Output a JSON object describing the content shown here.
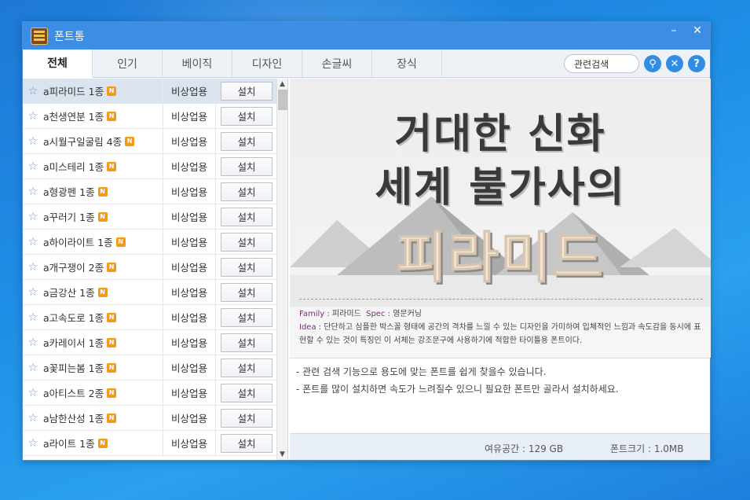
{
  "window": {
    "title": "폰트통"
  },
  "tabs": [
    {
      "label": "전체",
      "active": true
    },
    {
      "label": "인기",
      "active": false
    },
    {
      "label": "베이직",
      "active": false
    },
    {
      "label": "디자인",
      "active": false
    },
    {
      "label": "손글씨",
      "active": false
    },
    {
      "label": "장식",
      "active": false
    }
  ],
  "search": {
    "value": "관련검색"
  },
  "fonts": [
    {
      "name": "a피라미드 1종",
      "license": "비상업용",
      "action": "설치"
    },
    {
      "name": "a천생연분 1종",
      "license": "비상업용",
      "action": "설치"
    },
    {
      "name": "a시월구일굴림 4종",
      "license": "비상업용",
      "action": "설치"
    },
    {
      "name": "a미스테리 1종",
      "license": "비상업용",
      "action": "설치"
    },
    {
      "name": "a형광펜 1종",
      "license": "비상업용",
      "action": "설치"
    },
    {
      "name": "a꾸러기 1종",
      "license": "비상업용",
      "action": "설치"
    },
    {
      "name": "a하이라이트 1종",
      "license": "비상업용",
      "action": "설치"
    },
    {
      "name": "a개구쟁이 2종",
      "license": "비상업용",
      "action": "설치"
    },
    {
      "name": "a금강산 1종",
      "license": "비상업용",
      "action": "설치"
    },
    {
      "name": "a고속도로 1종",
      "license": "비상업용",
      "action": "설치"
    },
    {
      "name": "a카레이서 1종",
      "license": "비상업용",
      "action": "설치"
    },
    {
      "name": "a꽃피는봄 1종",
      "license": "비상업용",
      "action": "설치"
    },
    {
      "name": "a아티스트 2종",
      "license": "비상업용",
      "action": "설치"
    },
    {
      "name": "a남한산성 1종",
      "license": "비상업용",
      "action": "설치"
    },
    {
      "name": "a라이트 1종",
      "license": "비상업용",
      "action": "설치"
    }
  ],
  "badge_letter": "N",
  "preview": {
    "line1": "거대한 신화",
    "line2": "세계 불가사의",
    "line3": "피라미드",
    "family_label": "Family :",
    "family_value": "피라미드",
    "spec_label": "Spec :",
    "spec_value": "영문커닝",
    "idea_label": "Idea :",
    "idea_text": "단단하고 심플한 박스꼴 형태에 공간의 격차를 느낄 수 있는 디자인을 가미하여 입체적인 느낌과 속도감을 동시에 표현할 수 있는 것이 특징인 이 서체는 강조문구에 사용하기에 적합한 타이틀용 폰트이다."
  },
  "notes": [
    "- 관련 검색 기능으로 용도에 맞는 폰트를 쉽게 찾을수 있습니다.",
    "- 폰트를 많이 설치하면 속도가 느려질수 있으니 필요한 폰트만 골라서 설치하세요."
  ],
  "status": {
    "free_space": "여유공간 :   129 GB",
    "font_size": "폰트크기 :   1.0MB"
  },
  "colors": {
    "accent": "#3b8ee3",
    "badge": "#f39a1b"
  }
}
